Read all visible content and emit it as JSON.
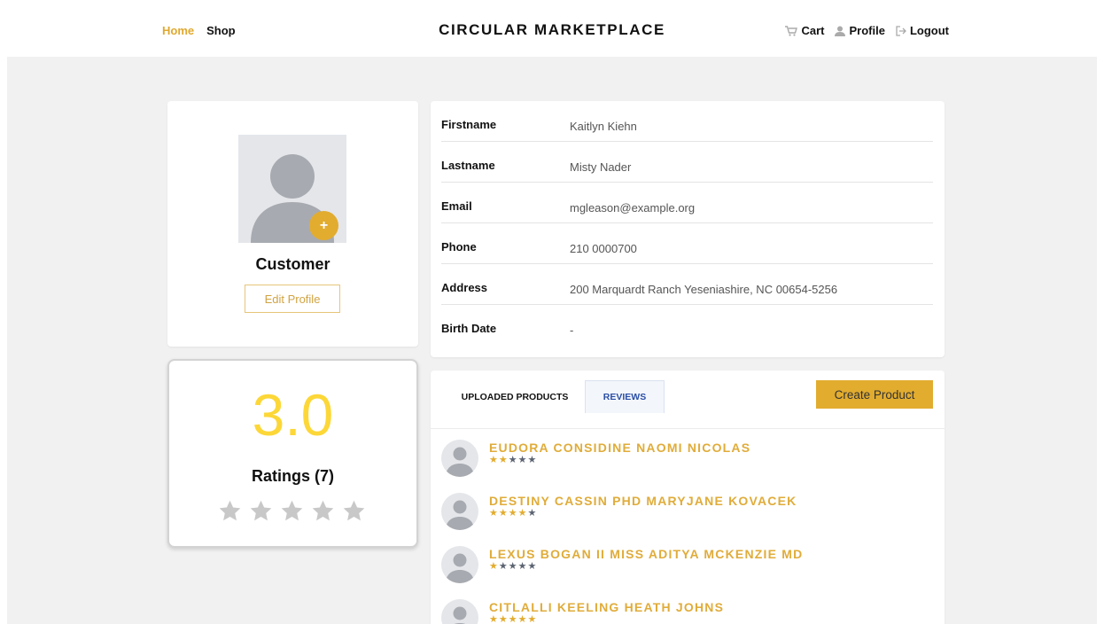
{
  "nav": {
    "home": "Home",
    "shop": "Shop",
    "brand": "CIRCULAR MARKETPLACE",
    "cart": "Cart",
    "profile": "Profile",
    "logout": "Logout",
    "active_color": "#e0a82e"
  },
  "profile": {
    "role": "Customer",
    "edit_label": "Edit Profile",
    "add_photo_label": "+"
  },
  "ratings": {
    "value": "3.0",
    "count_label": "Ratings (7)",
    "stars_filled": 0,
    "stars_total": 5
  },
  "info": [
    {
      "label": "Firstname",
      "value": "Kaitlyn Kiehn"
    },
    {
      "label": "Lastname",
      "value": "Misty Nader"
    },
    {
      "label": "Email",
      "value": "mgleason@example.org"
    },
    {
      "label": "Phone",
      "value": "210 0000700"
    },
    {
      "label": "Address",
      "value": "200 Marquardt Ranch Yeseniashire, NC 00654-5256"
    },
    {
      "label": "Birth Date",
      "value": "-"
    }
  ],
  "tabs": {
    "uploaded": "UPLOADED PRODUCTS",
    "reviews": "REVIEWS",
    "active": "reviews"
  },
  "create_product_label": "Create Product",
  "reviews": [
    {
      "name": "EUDORA CONSIDINE NAOMI NICOLAS",
      "rating": 2
    },
    {
      "name": "DESTINY CASSIN PHD MARYJANE KOVACEK",
      "rating": 4
    },
    {
      "name": "LEXUS BOGAN II MISS ADITYA MCKENZIE MD",
      "rating": 1
    },
    {
      "name": "CITLALLI KEELING HEATH JOHNS",
      "rating": 5
    }
  ],
  "colors": {
    "accent": "#e2ac2f",
    "rating_yellow": "#fcd737",
    "star_empty": "#c8c8c8",
    "star_small_empty": "#5b6372"
  }
}
